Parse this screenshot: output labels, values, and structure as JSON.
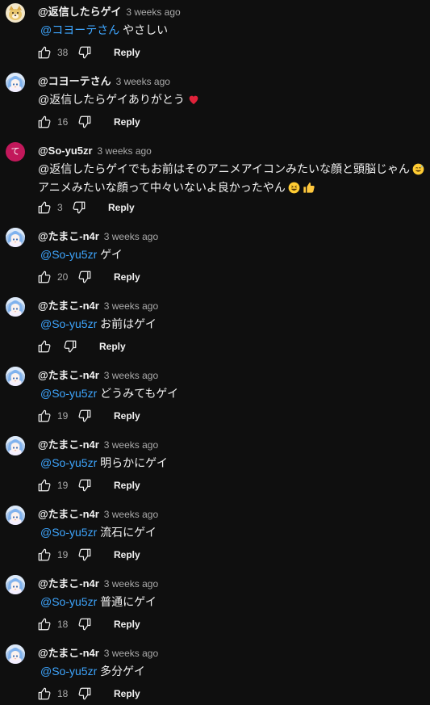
{
  "comments": [
    {
      "author": "@返信したらゲイ",
      "time": "3 weeks ago",
      "mention": "@コヨーテさん",
      "text": "やさしい",
      "likes": "38",
      "reply": "Reply",
      "avatar": "dog-avatar"
    },
    {
      "author": "@コヨーテさん",
      "time": "3 weeks ago",
      "mention": "",
      "text": "@返信したらゲイありがとう",
      "likes": "16",
      "reply": "Reply",
      "avatar": "anime-avatar",
      "emoji": "heart-icon"
    },
    {
      "author": "@So-yu5zr",
      "time": "3 weeks ago",
      "mention": "",
      "text": "@返信したらゲイでもお前はそのアニメアイコンみたいな顔と頭脳じゃん",
      "text2": "アニメみたいな顔って中々いないよ良かったやん",
      "likes": "3",
      "reply": "Reply",
      "avatar_letter": "て",
      "avatar_color": "#c2185b"
    },
    {
      "author": "@たまこ-n4r",
      "time": "3 weeks ago",
      "mention": "@So-yu5zr",
      "text": "ゲイ",
      "likes": "20",
      "reply": "Reply",
      "avatar": "anime-avatar"
    },
    {
      "author": "@たまこ-n4r",
      "time": "3 weeks ago",
      "mention": "@So-yu5zr",
      "text": "お前はゲイ",
      "likes": "",
      "reply": "Reply",
      "avatar": "anime-avatar"
    },
    {
      "author": "@たまこ-n4r",
      "time": "3 weeks ago",
      "mention": "@So-yu5zr",
      "text": "どうみてもゲイ",
      "likes": "19",
      "reply": "Reply",
      "avatar": "anime-avatar"
    },
    {
      "author": "@たまこ-n4r",
      "time": "3 weeks ago",
      "mention": "@So-yu5zr",
      "text": "明らかにゲイ",
      "likes": "19",
      "reply": "Reply",
      "avatar": "anime-avatar"
    },
    {
      "author": "@たまこ-n4r",
      "time": "3 weeks ago",
      "mention": "@So-yu5zr",
      "text": "流石にゲイ",
      "likes": "19",
      "reply": "Reply",
      "avatar": "anime-avatar"
    },
    {
      "author": "@たまこ-n4r",
      "time": "3 weeks ago",
      "mention": "@So-yu5zr",
      "text": "普通にゲイ",
      "likes": "18",
      "reply": "Reply",
      "avatar": "anime-avatar"
    },
    {
      "author": "@たまこ-n4r",
      "time": "3 weeks ago",
      "mention": "@So-yu5zr",
      "text": "多分ゲイ",
      "likes": "18",
      "reply": "Reply",
      "avatar": "anime-avatar"
    }
  ]
}
